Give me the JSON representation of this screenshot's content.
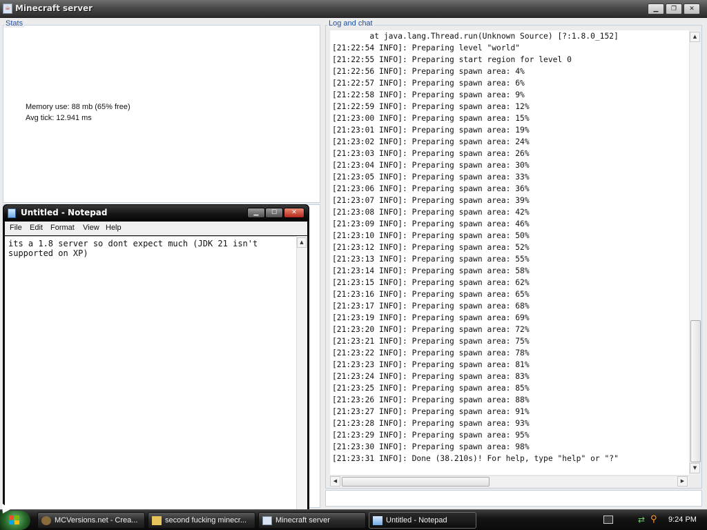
{
  "mc_window": {
    "title": "Minecraft server",
    "stats": {
      "legend": "Stats",
      "memory": "Memory use: 88 mb (65% free)",
      "tick": "Avg tick: 12.941 ms"
    },
    "log": {
      "legend": "Log and chat",
      "lines": [
        "        at java.lang.Thread.run(Unknown Source) [?:1.8.0_152]",
        "[21:22:54 INFO]: Preparing level \"world\"",
        "[21:22:55 INFO]: Preparing start region for level 0",
        "[21:22:56 INFO]: Preparing spawn area: 4%",
        "[21:22:57 INFO]: Preparing spawn area: 6%",
        "[21:22:58 INFO]: Preparing spawn area: 9%",
        "[21:22:59 INFO]: Preparing spawn area: 12%",
        "[21:23:00 INFO]: Preparing spawn area: 15%",
        "[21:23:01 INFO]: Preparing spawn area: 19%",
        "[21:23:02 INFO]: Preparing spawn area: 24%",
        "[21:23:03 INFO]: Preparing spawn area: 26%",
        "[21:23:04 INFO]: Preparing spawn area: 30%",
        "[21:23:05 INFO]: Preparing spawn area: 33%",
        "[21:23:06 INFO]: Preparing spawn area: 36%",
        "[21:23:07 INFO]: Preparing spawn area: 39%",
        "[21:23:08 INFO]: Preparing spawn area: 42%",
        "[21:23:09 INFO]: Preparing spawn area: 46%",
        "[21:23:10 INFO]: Preparing spawn area: 50%",
        "[21:23:12 INFO]: Preparing spawn area: 52%",
        "[21:23:13 INFO]: Preparing spawn area: 55%",
        "[21:23:14 INFO]: Preparing spawn area: 58%",
        "[21:23:15 INFO]: Preparing spawn area: 62%",
        "[21:23:16 INFO]: Preparing spawn area: 65%",
        "[21:23:17 INFO]: Preparing spawn area: 68%",
        "[21:23:19 INFO]: Preparing spawn area: 69%",
        "[21:23:20 INFO]: Preparing spawn area: 72%",
        "[21:23:21 INFO]: Preparing spawn area: 75%",
        "[21:23:22 INFO]: Preparing spawn area: 78%",
        "[21:23:23 INFO]: Preparing spawn area: 81%",
        "[21:23:24 INFO]: Preparing spawn area: 83%",
        "[21:23:25 INFO]: Preparing spawn area: 85%",
        "[21:23:26 INFO]: Preparing spawn area: 88%",
        "[21:23:27 INFO]: Preparing spawn area: 91%",
        "[21:23:28 INFO]: Preparing spawn area: 93%",
        "[21:23:29 INFO]: Preparing spawn area: 95%",
        "[21:23:30 INFO]: Preparing spawn area: 98%",
        "[21:23:31 INFO]: Done (38.210s)! For help, type \"help\" or \"?\""
      ]
    }
  },
  "notepad": {
    "title": "Untitled - Notepad",
    "menu": [
      "File",
      "Edit",
      "Format",
      "View",
      "Help"
    ],
    "text": "its a 1.8 server so dont expect much (JDK 21 isn't supported on XP)"
  },
  "taskbar": {
    "items": [
      {
        "label": "MCVersions.net - Crea...",
        "icon": "browser-icon",
        "active": false
      },
      {
        "label": "second fucking minecr...",
        "icon": "folder-icon",
        "active": false
      },
      {
        "label": "Minecraft server",
        "icon": "java-icon",
        "active": false
      },
      {
        "label": "Untitled - Notepad",
        "icon": "notepad-icon",
        "active": true
      }
    ],
    "clock": "9:24 PM"
  },
  "colors": {
    "legend_blue": "#1c4fa3",
    "panel_border": "#c4d0de",
    "start_green": "#2a6b2d"
  }
}
